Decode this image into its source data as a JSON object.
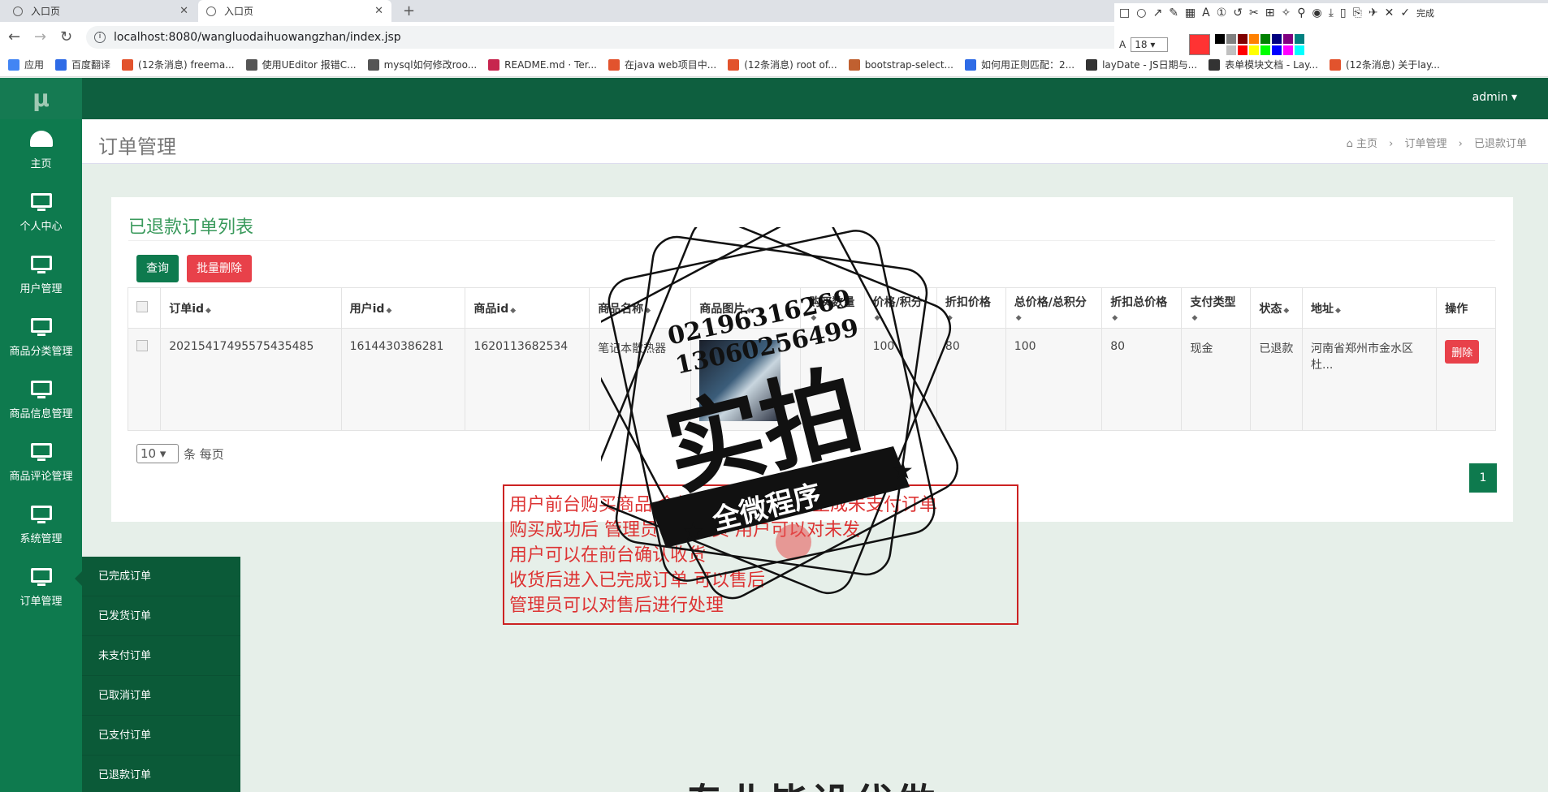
{
  "browser": {
    "tabs": [
      {
        "title": "入口页",
        "active": false
      },
      {
        "title": "入口页",
        "active": true
      }
    ],
    "url": "localhost:8080/wangluodaihuowangzhan/index.jsp",
    "bookmarks": [
      {
        "label": "应用",
        "color": "#4285f4"
      },
      {
        "label": "百度翻译",
        "color": "#2e6be6"
      },
      {
        "label": "(12条消息) freema...",
        "color": "#e2532d"
      },
      {
        "label": "使用UEditor 报错C...",
        "color": "#555555"
      },
      {
        "label": "mysql如何修改roo...",
        "color": "#555555"
      },
      {
        "label": "README.md · Ter...",
        "color": "#c7254e"
      },
      {
        "label": "在java web项目中...",
        "color": "#e2532d"
      },
      {
        "label": "(12条消息) root of...",
        "color": "#e2532d"
      },
      {
        "label": "bootstrap-select...",
        "color": "#c06030"
      },
      {
        "label": "如何用正则匹配：2...",
        "color": "#2e6be6"
      },
      {
        "label": "layDate - JS日期与...",
        "color": "#333333"
      },
      {
        "label": "表单模块文档 - Lay...",
        "color": "#333333"
      },
      {
        "label": "(12条消息) 关于lay...",
        "color": "#e2532d"
      }
    ]
  },
  "screenshot_tool": {
    "font_size": "18",
    "done_label": "完成",
    "current_color": "#ff3333",
    "palette": [
      "#000000",
      "#808080",
      "#800000",
      "#ff8000",
      "#008000",
      "#000080",
      "#800080",
      "#008080",
      "#ffffff",
      "#c0c0c0",
      "#ff0000",
      "#ffff00",
      "#00ff00",
      "#0000ff",
      "#ff00ff",
      "#00ffff"
    ]
  },
  "header": {
    "logo": "μ",
    "user": "admin ▾"
  },
  "sidebar": {
    "items": [
      {
        "label": "主页",
        "icon": "dashboard-icon"
      },
      {
        "label": "个人中心",
        "icon": "monitor-icon"
      },
      {
        "label": "用户管理",
        "icon": "monitor-icon"
      },
      {
        "label": "商品分类管理",
        "icon": "monitor-icon"
      },
      {
        "label": "商品信息管理",
        "icon": "monitor-icon"
      },
      {
        "label": "商品评论管理",
        "icon": "monitor-icon"
      },
      {
        "label": "系统管理",
        "icon": "monitor-icon"
      },
      {
        "label": "订单管理",
        "icon": "monitor-icon"
      }
    ],
    "submenu": [
      "已完成订单",
      "已发货订单",
      "未支付订单",
      "已取消订单",
      "已支付订单",
      "已退款订单"
    ]
  },
  "page": {
    "title": "订单管理",
    "breadcrumb": [
      "主页",
      "订单管理",
      "已退款订单"
    ]
  },
  "card": {
    "title": "已退款订单列表",
    "query_button": "查询",
    "batch_delete_button": "批量删除",
    "columns": [
      "订单id",
      "用户id",
      "商品id",
      "商品名称",
      "商品图片",
      "购买数量",
      "价格/积分",
      "折扣价格",
      "总价格/总积分",
      "折扣总价格",
      "支付类型",
      "状态",
      "地址",
      "操作"
    ],
    "rows": [
      {
        "order_id": "20215417495575435485",
        "user_id": "1614430386281",
        "goods_id": "1620113682534",
        "goods_name": "笔记本散热器",
        "quantity": "",
        "price": "100",
        "discount_price": "80",
        "total": "100",
        "discount_total": "80",
        "pay_type": "现金",
        "status": "已退款",
        "address": "河南省郑州市金水区杜...",
        "action": "删除"
      }
    ],
    "page_size": "10",
    "page_size_label": "条 每页",
    "current_page": "1"
  },
  "annotation": {
    "lines": [
      "用户前台购买商品 金额不够 可以下单 生成未支付订单",
      "购买成功后 管理员可以发货 用户可以对未发",
      "用户可以在前台确认收货",
      "收货后进入已完成订单 可以售后",
      "管理员可以对售后进行处理"
    ]
  },
  "watermark": {
    "phone1": "02196316269",
    "phone2": "13060256499",
    "big": "实拍",
    "banner": "全微程序"
  },
  "bottom_text": "专业毕设代做"
}
